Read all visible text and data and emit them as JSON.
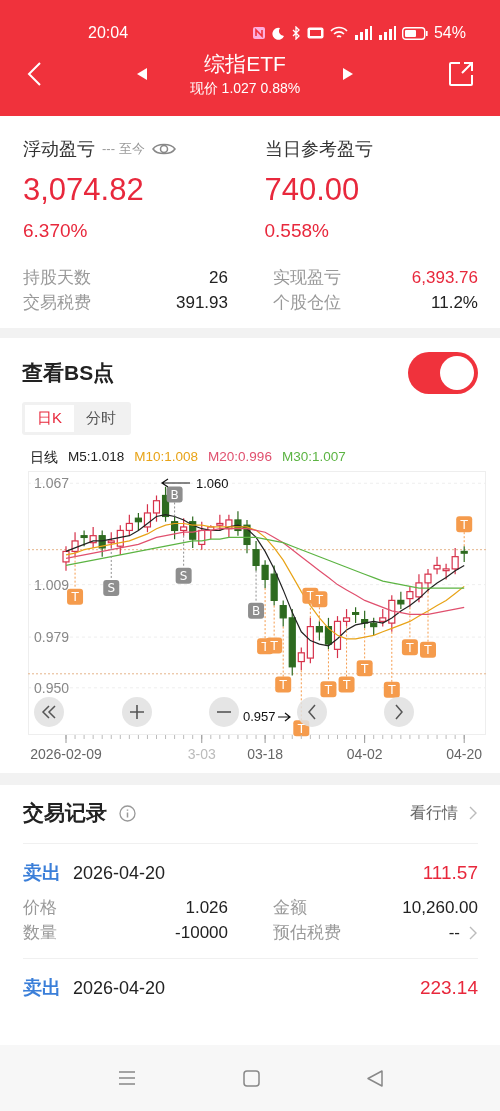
{
  "status_bar": {
    "time": "20:04",
    "battery": "54%"
  },
  "header": {
    "title": "综指ETF",
    "subtitle": "现价 1.027 0.88%"
  },
  "summary": {
    "floating": {
      "label": "浮动盈亏",
      "range": "--- 至今",
      "value": "3,074.82",
      "percent": "6.370%"
    },
    "daily": {
      "label": "当日参考盈亏",
      "value": "740.00",
      "percent": "0.558%"
    },
    "stats": [
      {
        "label": "持股天数",
        "value": "26",
        "highlight": false
      },
      {
        "label": "实现盈亏",
        "value": "6,393.76",
        "highlight": true
      },
      {
        "label": "交易税费",
        "value": "391.93",
        "highlight": false
      },
      {
        "label": "个股仓位",
        "value": "11.2%",
        "highlight": false
      }
    ]
  },
  "bs_section": {
    "title": "查看BS点",
    "toggle": {
      "on": true
    },
    "tabs": [
      {
        "label": "日K",
        "selected": true
      },
      {
        "label": "分时",
        "selected": false
      }
    ],
    "chart": {
      "period": "日线",
      "high_note": "1.060",
      "low_note": "0.957",
      "markers": [
        {
          "label": "B",
          "kind": "buy"
        },
        {
          "label": "S",
          "kind": "sell"
        },
        {
          "label": "S",
          "kind": "sell"
        },
        {
          "label": "T",
          "kind": "t"
        },
        {
          "label": "B",
          "kind": "buy"
        },
        {
          "label": "T",
          "kind": "t"
        },
        {
          "label": "T",
          "kind": "t"
        },
        {
          "label": "T",
          "kind": "t"
        },
        {
          "label": "T",
          "kind": "t"
        },
        {
          "label": "T",
          "kind": "t"
        },
        {
          "label": "T",
          "kind": "t"
        },
        {
          "label": "T",
          "kind": "t"
        },
        {
          "label": "T",
          "kind": "t"
        },
        {
          "label": "T",
          "kind": "t"
        },
        {
          "label": "T",
          "kind": "t"
        },
        {
          "label": "T",
          "kind": "t"
        },
        {
          "label": "T",
          "kind": "t"
        },
        {
          "label": "T",
          "kind": "t"
        }
      ],
      "chart_data": {
        "type": "candlestick",
        "categories": [
          "2026-02-09",
          null,
          null,
          null,
          null,
          null,
          null,
          null,
          null,
          null,
          null,
          null,
          null,
          null,
          null,
          "3-03",
          null,
          null,
          null,
          null,
          null,
          null,
          "03-18",
          null,
          null,
          null,
          null,
          null,
          null,
          null,
          null,
          null,
          null,
          "04-02",
          null,
          null,
          null,
          null,
          null,
          null,
          null,
          null,
          null,
          null,
          "04-20"
        ],
        "ohlc": [
          [
            1.022,
            1.031,
            1.017,
            1.028
          ],
          [
            1.028,
            1.039,
            1.025,
            1.034
          ],
          [
            1.037,
            1.04,
            1.031,
            1.036
          ],
          [
            1.033,
            1.042,
            1.03,
            1.037
          ],
          [
            1.037,
            1.04,
            1.025,
            1.03
          ],
          [
            1.033,
            1.039,
            1.03,
            1.034
          ],
          [
            1.031,
            1.043,
            1.026,
            1.04
          ],
          [
            1.04,
            1.049,
            1.037,
            1.044
          ],
          [
            1.047,
            1.05,
            1.04,
            1.045
          ],
          [
            1.042,
            1.055,
            1.039,
            1.05
          ],
          [
            1.05,
            1.06,
            1.045,
            1.057
          ],
          [
            1.06,
            1.065,
            1.045,
            1.048
          ],
          [
            1.045,
            1.048,
            1.035,
            1.04
          ],
          [
            1.04,
            1.047,
            1.037,
            1.042
          ],
          [
            1.045,
            1.048,
            1.03,
            1.035
          ],
          [
            1.032,
            1.045,
            1.029,
            1.04
          ],
          [
            1.04,
            1.043,
            1.035,
            1.042
          ],
          [
            1.043,
            1.049,
            1.04,
            1.044
          ],
          [
            1.041,
            1.049,
            1.036,
            1.046
          ],
          [
            1.046,
            1.051,
            1.037,
            1.04
          ],
          [
            1.043,
            1.046,
            1.027,
            1.032
          ],
          [
            1.029,
            1.034,
            1.017,
            1.02
          ],
          [
            1.02,
            1.023,
            1.007,
            1.012
          ],
          [
            1.015,
            1.02,
            0.997,
            1.0
          ],
          [
            0.997,
            1.0,
            0.985,
            0.99
          ],
          [
            0.99,
            0.995,
            0.957,
            0.962
          ],
          [
            0.965,
            0.973,
            0.96,
            0.97
          ],
          [
            0.967,
            0.99,
            0.964,
            0.985
          ],
          [
            0.985,
            0.988,
            0.977,
            0.982
          ],
          [
            0.985,
            0.99,
            0.972,
            0.975
          ],
          [
            0.972,
            0.991,
            0.967,
            0.988
          ],
          [
            0.988,
            0.995,
            0.985,
            0.99
          ],
          [
            0.993,
            0.996,
            0.987,
            0.992
          ],
          [
            0.989,
            0.994,
            0.984,
            0.987
          ],
          [
            0.987,
            0.99,
            0.98,
            0.985
          ],
          [
            0.988,
            0.995,
            0.985,
            0.99
          ],
          [
            0.987,
            1.003,
            0.982,
            1.0
          ],
          [
            1.0,
            1.005,
            0.995,
            0.998
          ],
          [
            1.001,
            1.008,
            0.996,
            1.005
          ],
          [
            1.002,
            1.015,
            0.999,
            1.01
          ],
          [
            1.01,
            1.018,
            1.005,
            1.015
          ],
          [
            1.018,
            1.025,
            1.015,
            1.02
          ],
          [
            1.017,
            1.021,
            1.012,
            1.018
          ],
          [
            1.018,
            1.03,
            1.015,
            1.025
          ],
          [
            1.028,
            1.031,
            1.022,
            1.027
          ]
        ],
        "ylim": [
          0.923,
          1.074
        ],
        "grid": true,
        "ref_lines": [
          {
            "axis": "y",
            "value": 1.029
          },
          {
            "axis": "y",
            "value": 0.958
          }
        ],
        "yticks": [
          {
            "value": 1.067,
            "label": "1.067"
          },
          {
            "value": 1.009,
            "label": "1.009"
          },
          {
            "value": 0.979,
            "label": "0.979"
          },
          {
            "value": 0.95,
            "label": "0.950"
          }
        ],
        "series": [
          {
            "name": "M5:1.018",
            "type": "line",
            "color": "#222222",
            "values": [
              1.028,
              1.03,
              1.032,
              1.034,
              1.034,
              1.035,
              1.036,
              1.037,
              1.04,
              1.044,
              1.048,
              1.049,
              1.048,
              1.046,
              1.043,
              1.041,
              1.04,
              1.04,
              1.042,
              1.043,
              1.041,
              1.036,
              1.028,
              1.018,
              1.006,
              0.993,
              0.982,
              0.977,
              0.975,
              0.974,
              0.978,
              0.983,
              0.986,
              0.987,
              0.988,
              0.987,
              0.99,
              0.994,
              0.997,
              1.001,
              1.006,
              1.01,
              1.013,
              1.017,
              1.02
            ]
          },
          {
            "name": "M10:1.008",
            "type": "line",
            "color": "#e8a317",
            "values": [
              1.026,
              1.027,
              1.029,
              1.03,
              1.031,
              1.032,
              1.033,
              1.034,
              1.036,
              1.038,
              1.041,
              1.043,
              1.044,
              1.044,
              1.043,
              1.043,
              1.042,
              1.042,
              1.042,
              1.042,
              1.042,
              1.04,
              1.036,
              1.03,
              1.023,
              1.014,
              1.005,
              0.997,
              0.99,
              0.984,
              0.98,
              0.978,
              0.978,
              0.979,
              0.98,
              0.982,
              0.984,
              0.986,
              0.988,
              0.991,
              0.994,
              0.997,
              1.0,
              1.004,
              1.008
            ]
          },
          {
            "name": "M20:0.996",
            "type": "line",
            "color": "#e0506e",
            "values": [
              1.024,
              1.025,
              1.026,
              1.027,
              1.028,
              1.029,
              1.03,
              1.031,
              1.032,
              1.034,
              1.036,
              1.037,
              1.038,
              1.039,
              1.039,
              1.04,
              1.04,
              1.041,
              1.041,
              1.041,
              1.041,
              1.04,
              1.039,
              1.036,
              1.033,
              1.029,
              1.025,
              1.021,
              1.017,
              1.013,
              1.009,
              1.006,
              1.003,
              1.0,
              0.998,
              0.996,
              0.994,
              0.993,
              0.992,
              0.992,
              0.992,
              0.993,
              0.994,
              0.995,
              0.996
            ]
          },
          {
            "name": "M30:1.007",
            "type": "line",
            "color": "#5cb443",
            "values": [
              1.02,
              1.021,
              1.022,
              1.023,
              1.024,
              1.025,
              1.026,
              1.027,
              1.028,
              1.029,
              1.03,
              1.031,
              1.032,
              1.033,
              1.034,
              1.034,
              1.035,
              1.035,
              1.036,
              1.036,
              1.036,
              1.036,
              1.035,
              1.034,
              1.033,
              1.031,
              1.029,
              1.027,
              1.025,
              1.023,
              1.021,
              1.019,
              1.017,
              1.015,
              1.013,
              1.011,
              1.01,
              1.009,
              1.008,
              1.007,
              1.007,
              1.007,
              1.007,
              1.007,
              1.007
            ]
          }
        ]
      }
    }
  },
  "records": {
    "title": "交易记录",
    "link": "看行情",
    "items": [
      {
        "type": "卖出",
        "date": "2026-04-20",
        "amount": "111.57",
        "details": [
          {
            "label": "价格",
            "value": "1.026",
            "chevron": false
          },
          {
            "label": "金额",
            "value": "10,260.00",
            "chevron": false
          },
          {
            "label": "数量",
            "value": "-10000",
            "chevron": false
          },
          {
            "label": "预估税费",
            "value": "--",
            "chevron": true
          }
        ]
      },
      {
        "type": "卖出",
        "date": "2026-04-20",
        "amount": "223.14"
      }
    ]
  }
}
